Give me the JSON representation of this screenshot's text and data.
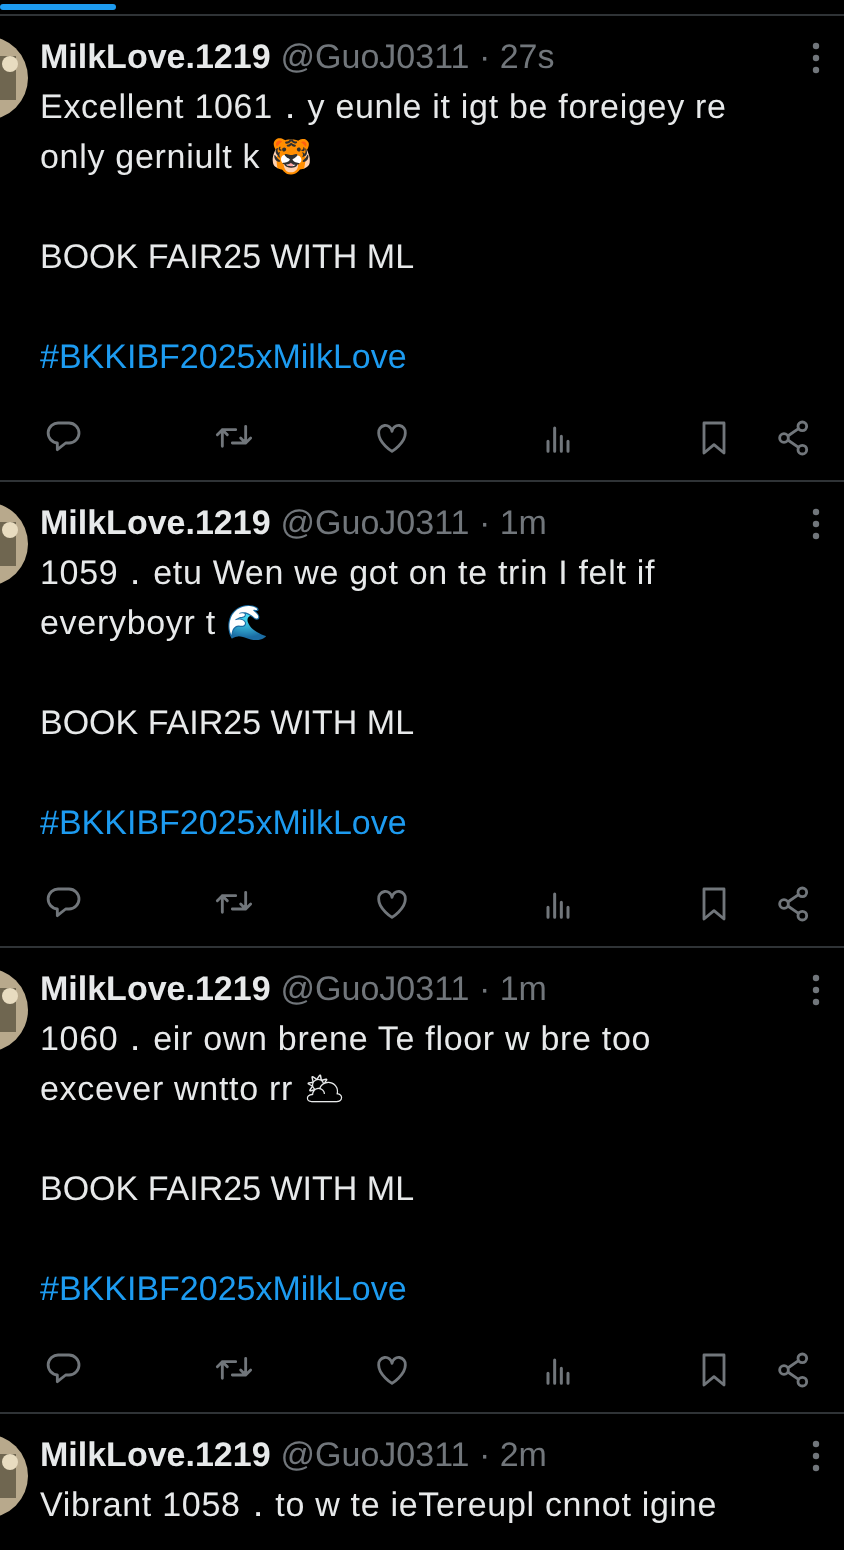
{
  "tab_indicator": {
    "selected": true
  },
  "tweets": [
    {
      "name": "MilkLove.1219",
      "meta": "@GuoJ0311 · 27s",
      "text": "Excellent 1061．y eunle it igt be foreigey re\nonly gerniult k 🐯",
      "tagline": "BOOK FAIR25 WITH ML",
      "hashtag": "#BKKIBF2025xMilkLove",
      "cut_off": false
    },
    {
      "name": "MilkLove.1219",
      "meta": "@GuoJ0311 · 1m",
      "text": "1059．etu Wen we got on te trin I felt  if\neveryboyr t 🌊",
      "tagline": "BOOK FAIR25 WITH ML",
      "hashtag": "#BKKIBF2025xMilkLove",
      "cut_off": false
    },
    {
      "name": "MilkLove.1219",
      "meta": "@GuoJ0311 · 1m",
      "text": "1060．eir own brene Te floor w bre too\nexcever wntto rr 🌥",
      "tagline": "BOOK FAIR25 WITH ML",
      "hashtag": "#BKKIBF2025xMilkLove",
      "cut_off": false
    },
    {
      "name": "MilkLove.1219",
      "meta": "@GuoJ0311 · 2m",
      "text": "Vibrant 1058．to w te ieTereupl  cnnot igine",
      "cut_off": true
    }
  ]
}
